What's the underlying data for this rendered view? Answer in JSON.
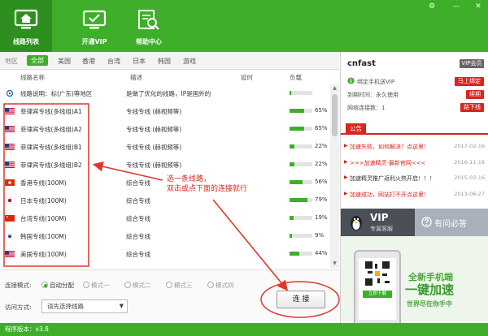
{
  "tabs": [
    {
      "label": "线路列表",
      "icon": "home-icon",
      "active": true
    },
    {
      "label": "开通VIP",
      "icon": "tv-icon",
      "active": false
    },
    {
      "label": "帮助中心",
      "icon": "help-search-icon",
      "active": false
    }
  ],
  "regions": {
    "label": "地区",
    "items": [
      "全部",
      "美国",
      "香港",
      "台湾",
      "日本",
      "韩国",
      "游戏"
    ],
    "active": "全部"
  },
  "table": {
    "headers": [
      "线路名称",
      "描述",
      "延时",
      "负载"
    ],
    "rows": [
      {
        "flag": "cn-telecom",
        "name": "线路说明：标(广东)等地区",
        "desc": "是做了优化的线路，IP是国外的",
        "load": 0.08,
        "pct": ""
      },
      {
        "flag": "us",
        "name": "菲律宾专线(多线组)A1",
        "desc": "专线专线 (赫视频等)",
        "load": 0.65,
        "pct": "65%"
      },
      {
        "flag": "us",
        "name": "菲律宾专线(多线组)A2",
        "desc": "专线专线 (赫视频等)",
        "load": 0.65,
        "pct": "65%"
      },
      {
        "flag": "us",
        "name": "菲律宾专线(多线组)B1",
        "desc": "专线专线 (赫视频等)",
        "load": 0.22,
        "pct": "22%"
      },
      {
        "flag": "us",
        "name": "菲律宾专线(多线组)B2",
        "desc": "专线专线 (赫视频等)",
        "load": 0.22,
        "pct": "22%"
      },
      {
        "flag": "hk",
        "name": "香港专线(100M)",
        "desc": "综合专线",
        "load": 0.56,
        "pct": "56%"
      },
      {
        "flag": "jp",
        "name": "日本专线(100M)",
        "desc": "综合专线",
        "load": 0.79,
        "pct": "79%"
      },
      {
        "flag": "tw",
        "name": "台湾专线(100M)",
        "desc": "综合专线",
        "load": 0.19,
        "pct": "19%"
      },
      {
        "flag": "kr",
        "name": "韩国专线(100M)",
        "desc": "综合专线",
        "load": 0.09,
        "pct": "9%"
      },
      {
        "flag": "us",
        "name": "美国专线(100M)",
        "desc": "综合专线",
        "load": 0.44,
        "pct": "44%"
      }
    ]
  },
  "annotation": {
    "line1": "选一条线路，",
    "line2": "双击或点下面的连接就行"
  },
  "connect_mode": {
    "label": "连接模式:",
    "options": [
      "自动分配",
      "模式一",
      "模式二",
      "模式三",
      "模式四"
    ],
    "selected": "自动分配"
  },
  "access": {
    "label": "访问方式:",
    "value": "请先选择线路"
  },
  "connect_button": "连 接",
  "status_bar": "程序版本：v3.8",
  "user": {
    "name": "cnfast",
    "vip_badge": "VIP会员",
    "bind_vip": "绑定手机送VIP",
    "bind_btn": "马上绑定",
    "expiry": "到期时间：永久使用",
    "renew_btn": "续期",
    "switch_count": "网络连接数：1",
    "switch_btn": "路下线"
  },
  "notices": {
    "tab": "公告",
    "items": [
      {
        "text": "加速失败，如何解决？点这里！",
        "date": "2017-02-16",
        "style": "red"
      },
      {
        "text": ">>>加速精灵·最新官网<<<",
        "date": "2016-11-18",
        "style": "red"
      },
      {
        "text": "加速精灵推广返利火热开启！！！",
        "date": "2015-03-16",
        "style": "dark"
      },
      {
        "text": "加速成功，网站打不开点这里！",
        "date": "2013-06-27",
        "style": "red"
      }
    ]
  },
  "service": {
    "vip_title": "VIP",
    "vip_sub": "专属客服",
    "qa": "有问必答"
  },
  "ad": {
    "line1": "全新手机端",
    "line2": "一键加速",
    "line3": "世界尽在你手中",
    "download": "立即下载"
  },
  "colors": {
    "brand_green": "#3fae2a",
    "accent_red": "#d8261c"
  }
}
